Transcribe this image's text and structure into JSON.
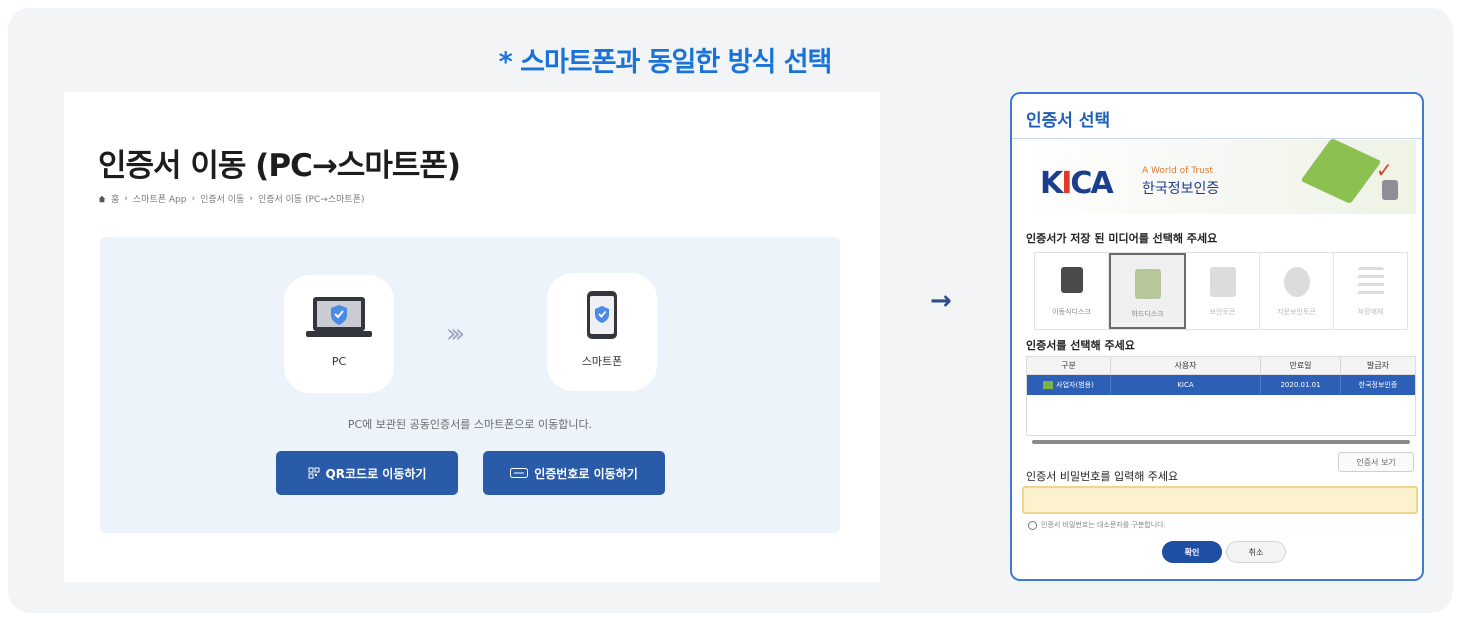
{
  "headline": "* 스마트폰과 동일한 방식 선택",
  "web": {
    "title": "인증서 이동 (PC→스마트폰)",
    "breadcrumb": [
      "홈",
      "스마트폰 App",
      "인증서 이동",
      "인증서 이동 (PC→스마트폰)"
    ],
    "pc_label": "PC",
    "phone_label": "스마트폰",
    "description": "PC에 보관된 공동인증서를 스마트폰으로 이동합니다.",
    "qr_button": "QR코드로 이동하기",
    "number_button": "인증번호로 이동하기"
  },
  "arrow": "→",
  "dialog": {
    "title": "인증서 선택",
    "logo_text": "KICA",
    "logo_tagline": "A World of Trust",
    "logo_name": "한국정보인증",
    "media_prompt": "인증서가 저장 된 미디어를 선택해 주세요",
    "media": [
      {
        "label": "이동식디스크",
        "icon": "usb-drive-icon",
        "state": "enabled"
      },
      {
        "label": "하드디스크",
        "icon": "hard-disk-icon",
        "state": "selected"
      },
      {
        "label": "보안토큰",
        "icon": "security-token-icon",
        "state": "disabled"
      },
      {
        "label": "지문보안토큰",
        "icon": "fingerprint-token-icon",
        "state": "disabled"
      },
      {
        "label": "저장매체",
        "icon": "list-icon",
        "state": "disabled"
      }
    ],
    "cert_prompt": "인증서를 선택해 주세요",
    "columns": [
      "구분",
      "사용자",
      "만료일",
      "발급자"
    ],
    "rows": [
      [
        "사업자(범용)",
        "KICA",
        "2020.01.01",
        "한국정보인증"
      ]
    ],
    "view_button": "인증서 보기",
    "password_prompt": "인증서 비밀번호를 입력해 주세요",
    "password_value": "",
    "hint": "인증서 비밀번호는 대소문자를 구분합니다.",
    "ok_button": "확인",
    "cancel_button": "취소"
  },
  "colors": {
    "headline": "#1a73d9",
    "primary_button": "#2a5ba8",
    "selected_row": "#2d5fb7",
    "dialog_border": "#3d7bd6"
  }
}
